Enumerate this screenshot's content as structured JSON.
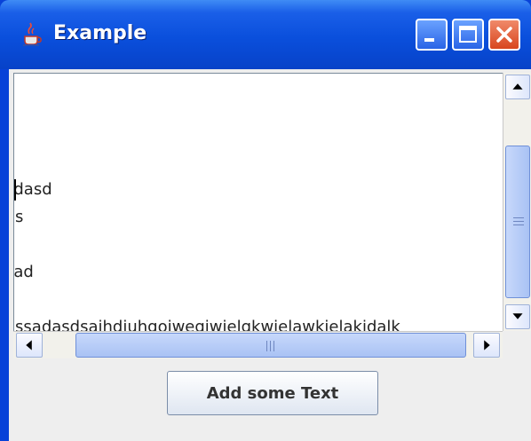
{
  "window": {
    "title": "Example",
    "icon": "java-cup-icon",
    "controls": [
      "minimize-icon",
      "maximize-icon",
      "close-icon"
    ]
  },
  "text_area": {
    "lines": [
      "sdasd",
      "as",
      "s",
      "sad",
      "",
      "assadasdsaihdiuhgoiwegiwielgkwielawkielakidalk"
    ]
  },
  "button": {
    "label": "Add some Text"
  },
  "colors": {
    "title_bar": "#0a4fdc",
    "close_button": "#d8461e",
    "scroll_thumb": "#b8cdf7"
  }
}
